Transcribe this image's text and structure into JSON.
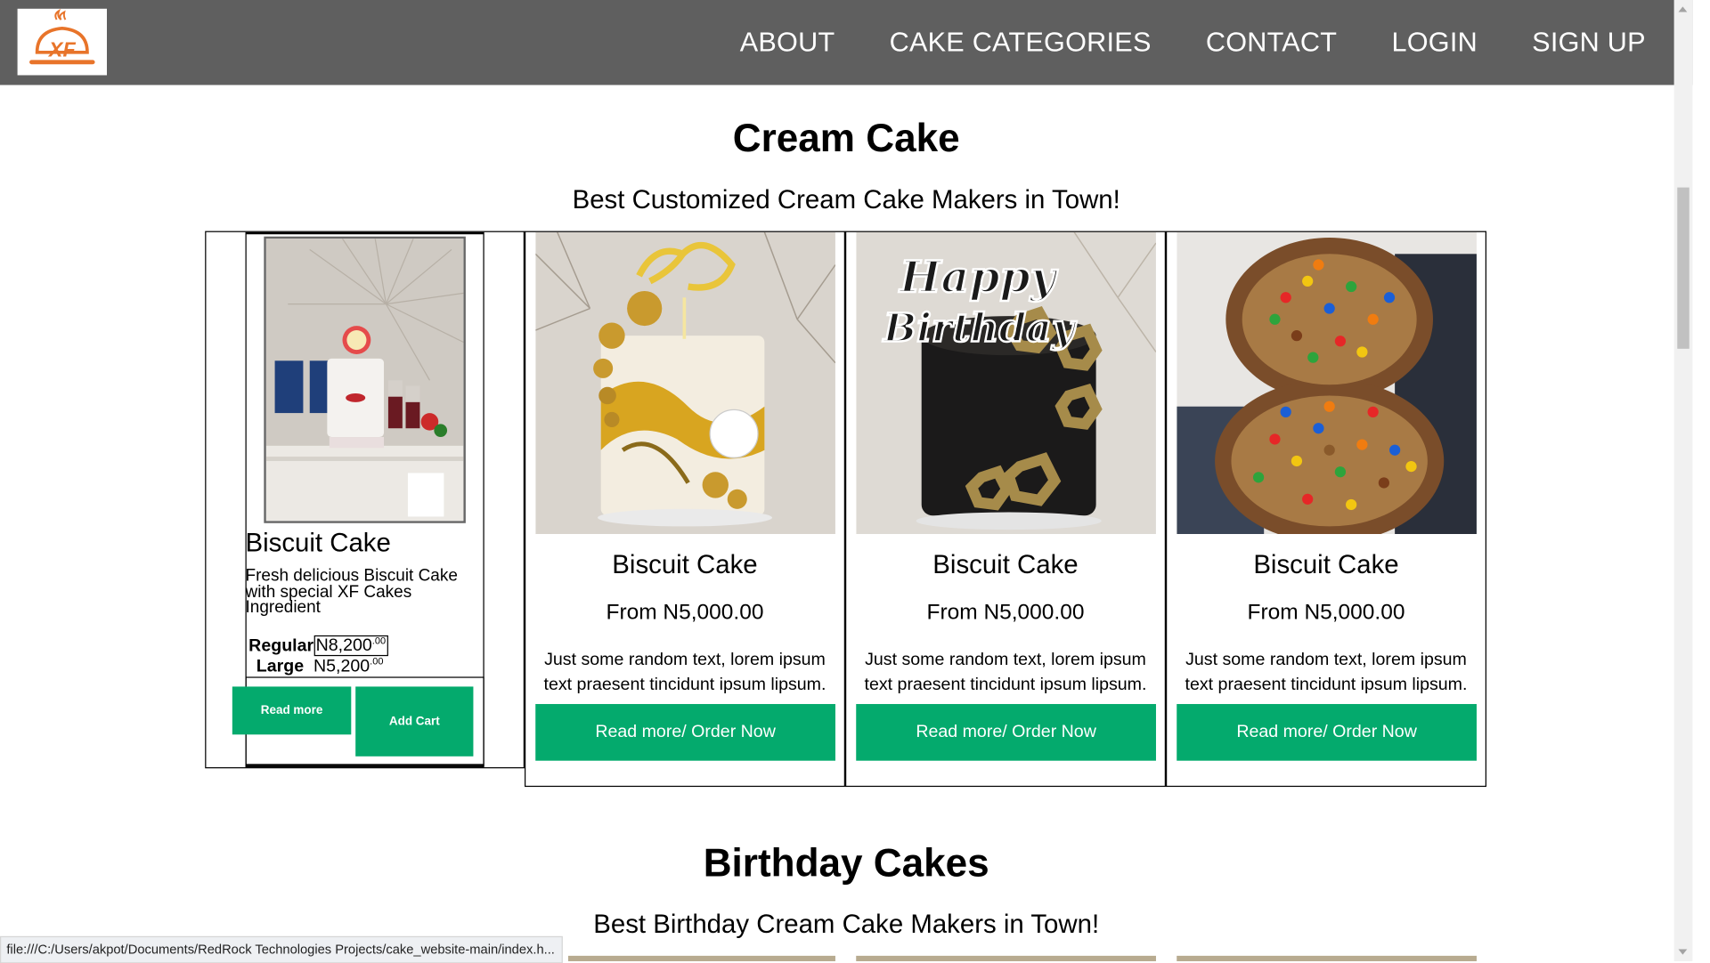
{
  "nav": {
    "logo_text": "XF",
    "items": [
      "ABOUT",
      "CAKE CATEGORIES",
      "CONTACT",
      "LOGIN",
      "SIGN UP"
    ]
  },
  "sections": [
    {
      "title": "Cream Cake",
      "subtitle": "Best Customized Cream Cake Makers in Town!"
    },
    {
      "title": "Birthday Cakes",
      "subtitle": "Best Birthday Cream Cake Makers in Town!"
    }
  ],
  "featured": {
    "name": "Biscuit Cake",
    "description": "Fresh delicious Biscuit Cake with special XF Cakes Ingredient",
    "prices": [
      {
        "label": "Regular",
        "amount": "N8,200",
        "cents": ".00"
      },
      {
        "label": "Large",
        "amount": "N5,200",
        "cents": ".00"
      }
    ],
    "read_more": "Read more",
    "add_cart": "Add Cart"
  },
  "cards": [
    {
      "name": "Biscuit Cake",
      "price": "From N5,000.00",
      "text": "Just some random text, lorem ipsum text praesent tincidunt ipsum lipsum.",
      "button": "Read more/ Order Now"
    },
    {
      "name": "Biscuit Cake",
      "price": "From N5,000.00",
      "text": "Just some random text, lorem ipsum text praesent tincidunt ipsum lipsum.",
      "button": "Read more/ Order Now"
    },
    {
      "name": "Biscuit Cake",
      "price": "From N5,000.00",
      "text": "Just some random text, lorem ipsum text praesent tincidunt ipsum lipsum.",
      "button": "Read more/ Order Now"
    }
  ],
  "status_bar": "file:///C:/Users/akpot/Documents/RedRock Technologies Projects/cake_website-main/index.h...",
  "colors": {
    "nav_bg": "#5f5f5f",
    "accent": "#04aa6d",
    "logo_orange": "#e8742a"
  }
}
